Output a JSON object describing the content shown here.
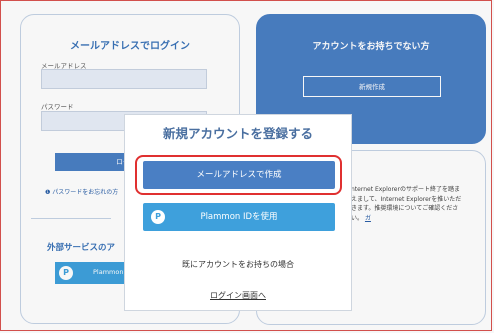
{
  "login": {
    "title": "メールアドレスでログイン",
    "email_label": "メールアドレス",
    "password_label": "パスワード",
    "login_button": "ログイン",
    "forgot_link": "パスワードをお忘れの方",
    "external_title": "外部サービスのア",
    "plammon_button": "Plammon"
  },
  "no_account": {
    "title": "アカウントをお持ちでない方",
    "register_button": "新規作成"
  },
  "notice": {
    "text": "nternet Explorerのサポート終了を踏まえまして、Internet Explorerを推いただきます。推奨環境についてご確認ください。",
    "link": "ガ"
  },
  "modal": {
    "title": "新規アカウントを登録する",
    "email_create_button": "メールアドレスで作成",
    "plammon_button": "Plammon IDを使用",
    "already_text": "既にアカウントをお持ちの場合",
    "login_link": "ログイン画面へ"
  },
  "colors": {
    "primary": "#4a7fc4",
    "secondary": "#3ea0dc",
    "highlight": "#e03030"
  }
}
